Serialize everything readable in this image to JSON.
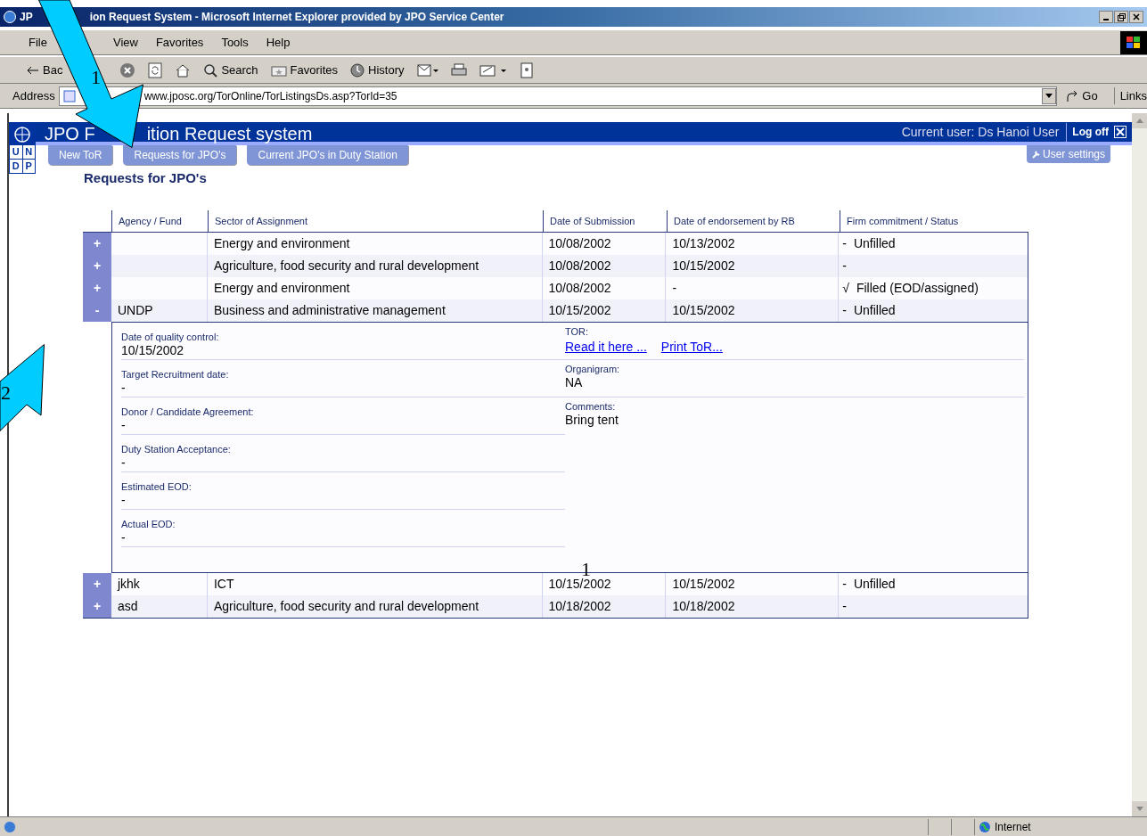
{
  "window": {
    "title_parts": [
      "JP",
      "ion Request System - Microsoft Internet Explorer provided by JPO Service Center"
    ]
  },
  "menu": [
    "File",
    "View",
    "Favorites",
    "Tools",
    "Help"
  ],
  "toolbar": {
    "back": "Bac",
    "search": "Search",
    "favorites": "Favorites",
    "history": "History"
  },
  "address": {
    "label": "Address",
    "url": "www.jposc.org/TorOnline/TorListingsDs.asp?TorId=35",
    "go": "Go",
    "links": "Links"
  },
  "app": {
    "title_parts": [
      "JPO F",
      "ition Request system"
    ],
    "user": "Current user: Ds Hanoi User",
    "logoff": "Log off",
    "logo_letters": [
      "U",
      "N",
      "D",
      "P"
    ],
    "nav": [
      {
        "label": "New ToR"
      },
      {
        "label": "Requests for JPO's"
      },
      {
        "label": "Current JPO's in Duty Station"
      }
    ],
    "settings": "User settings"
  },
  "heading": "Requests for JPO's",
  "table": {
    "columns": [
      "Agency / Fund",
      "Sector of Assignment",
      "Date of Submission",
      "Date of endorsement by RB",
      "Firm commitment / Status"
    ],
    "rows": [
      {
        "toggle": "+",
        "agency": "",
        "sector": "Energy and environment",
        "submitted": "10/08/2002",
        "endorsed": "10/13/2002",
        "status_mark": "-",
        "status": "Unfilled"
      },
      {
        "toggle": "+",
        "agency": "",
        "sector": "Agriculture, food security and rural development",
        "submitted": "10/08/2002",
        "endorsed": "10/15/2002",
        "status_mark": "-",
        "status": ""
      },
      {
        "toggle": "+",
        "agency": "",
        "sector": "Energy and environment",
        "submitted": "10/08/2002",
        "endorsed": "-",
        "status_mark": "√",
        "status": "Filled (EOD/assigned)"
      },
      {
        "toggle": "-",
        "agency": "UNDP",
        "sector": "Business and administrative management",
        "submitted": "10/15/2002",
        "endorsed": "10/15/2002",
        "status_mark": "-",
        "status": "Unfilled",
        "detail": {
          "left": [
            {
              "label": "Date of quality control:",
              "value": "10/15/2002"
            },
            {
              "label": "Target Recruitment date:",
              "value": "-"
            },
            {
              "label": "Donor / Candidate Agreement:",
              "value": "-"
            },
            {
              "label": "Duty Station Acceptance:",
              "value": "-"
            },
            {
              "label": "Estimated EOD:",
              "value": "-"
            },
            {
              "label": "Actual EOD:",
              "value": "-"
            }
          ],
          "tor": {
            "label": "TOR:",
            "links": [
              "Read it here ...",
              "Print ToR..."
            ]
          },
          "organigram": {
            "label": "Organigram:",
            "value": "NA"
          },
          "comments": {
            "label": "Comments:",
            "value": "Bring tent"
          }
        }
      },
      {
        "toggle": "+",
        "agency": "jkhk",
        "sector": "ICT",
        "submitted": "10/15/2002",
        "endorsed": "10/15/2002",
        "status_mark": "-",
        "status": "Unfilled"
      },
      {
        "toggle": "+",
        "agency": "asd",
        "sector": "Agriculture, food security and rural development",
        "submitted": "10/18/2002",
        "endorsed": "10/18/2002",
        "status_mark": "-",
        "status": ""
      }
    ]
  },
  "status_bar": {
    "zone": "Internet"
  },
  "annotations": [
    {
      "kind": "arrow-down",
      "number": "1"
    },
    {
      "kind": "arrow-up",
      "number": "2"
    },
    {
      "kind": "label",
      "number": "1"
    }
  ]
}
